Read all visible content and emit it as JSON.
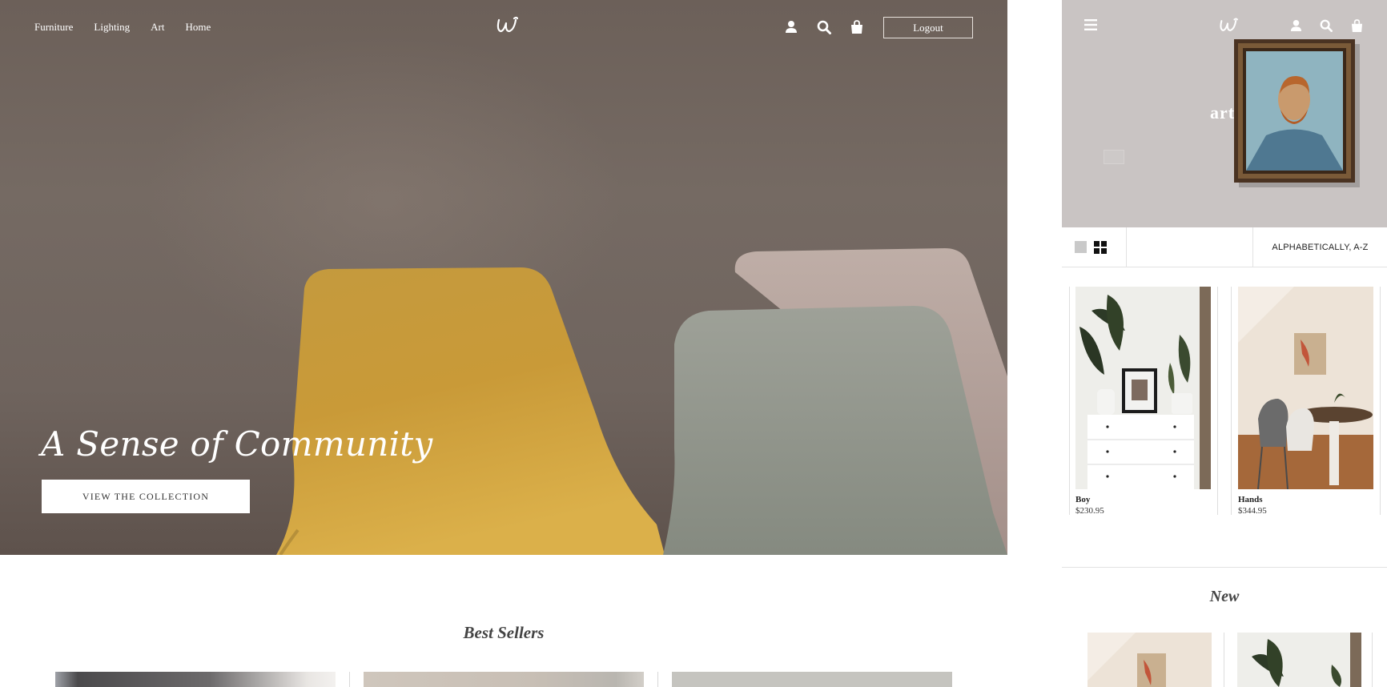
{
  "desktop": {
    "nav": [
      "Furniture",
      "Lighting",
      "Art",
      "Home"
    ],
    "logo": "W",
    "icons": [
      "user-icon",
      "search-icon",
      "shopping-bag-icon"
    ],
    "logout_label": "Logout",
    "hero": {
      "title": "A Sense of Community",
      "cta_label": "VIEW THE COLLECTION"
    },
    "best_sellers_title": "Best Sellers"
  },
  "mobile": {
    "logo": "W",
    "icons": [
      "menu-icon",
      "user-icon",
      "search-icon",
      "shopping-bag-icon"
    ],
    "category_title": "art",
    "sort_label": "ALPHABETICALLY, A-Z",
    "view_options": [
      "grid-single-icon",
      "grid-double-icon"
    ],
    "products": [
      {
        "name": "Boy",
        "price": "$230.95"
      },
      {
        "name": "Hands",
        "price": "$344.95"
      }
    ],
    "new_title": "New"
  },
  "colors": {
    "hero_bg": "#6f645e",
    "chair_yellow": "#d4a33c",
    "chair_sage": "#8e948a",
    "chair_pink": "#b7a6a0",
    "mobile_banner": "#c9c4c3",
    "accent_dark": "#222222"
  }
}
